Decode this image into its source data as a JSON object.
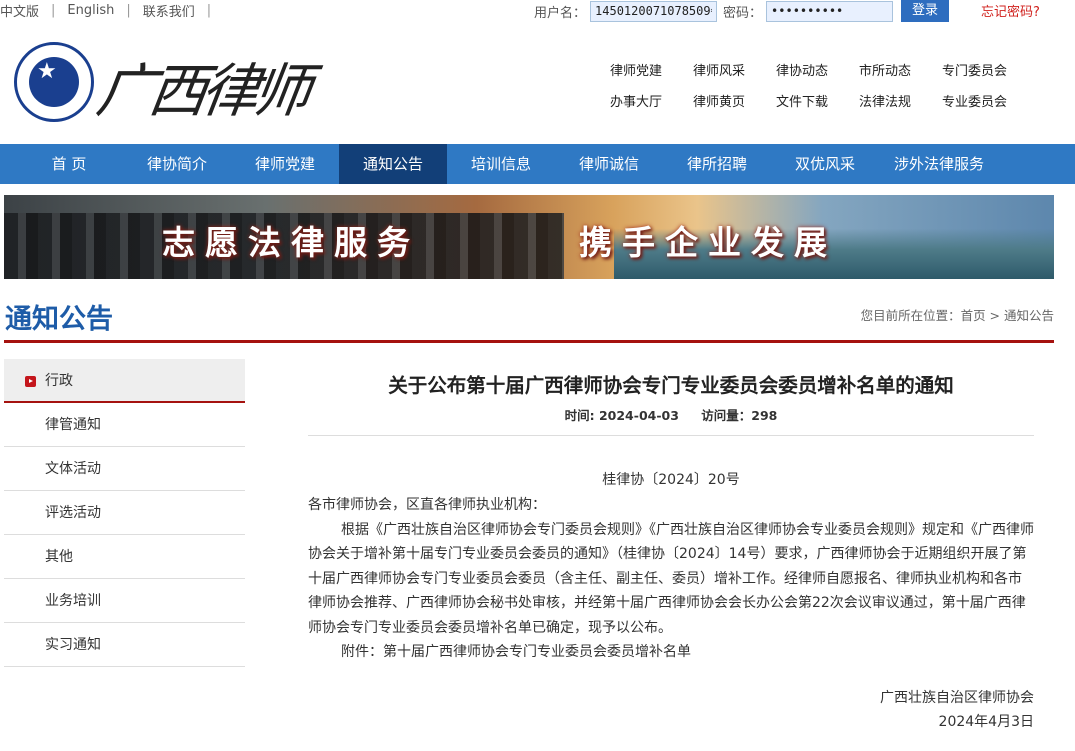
{
  "topbar": {
    "lang_cn": "中文版",
    "lang_en": "English",
    "contact": "联系我们",
    "username_label": "用户名：",
    "username_value": "1450120071078509€",
    "password_label": "密码：",
    "password_value": "••••••••••",
    "login_label": "登录",
    "forgot_label": "忘记密码?"
  },
  "header": {
    "logo_text": "广西律师",
    "quick_links": [
      "律师党建",
      "律师风采",
      "律协动态",
      "市所动态",
      "专门委员会",
      "办事大厅",
      "律师黄页",
      "文件下载",
      "法律法规",
      "专业委员会"
    ]
  },
  "nav": {
    "items": [
      "首 页",
      "律协简介",
      "律师党建",
      "通知公告",
      "培训信息",
      "律师诚信",
      "律所招聘",
      "双优风采",
      "涉外法律服务"
    ],
    "active": "通知公告"
  },
  "banner": {
    "slogan_left": "志愿法律服务",
    "slogan_right": "携手企业发展"
  },
  "section": {
    "title": "通知公告",
    "breadcrumb": "您目前所在位置：首页 > 通知公告"
  },
  "sidebar": {
    "items": [
      "行政",
      "律管通知",
      "文体活动",
      "评选活动",
      "其他",
      "业务培训",
      "实习通知"
    ]
  },
  "article": {
    "title": "关于公布第十届广西律师协会专门专业委员会委员增补名单的通知",
    "date": "时间: 2024-04-03",
    "views": "访问量：298",
    "doc_no": "桂律协〔2024〕20号",
    "salutation": "各市律师协会，区直各律师执业机构：",
    "body": "根据《广西壮族自治区律师协会专门委员会规则》《广西壮族自治区律师协会专业委员会规则》规定和《广西律师协会关于增补第十届专门专业委员会委员的通知》（桂律协〔2024〕14号）要求，广西律师协会于近期组织开展了第十届广西律师协会专门专业委员会委员（含主任、副主任、委员）增补工作。经律师自愿报名、律师执业机构和各市律师协会推荐、广西律师协会秘书处审核，并经第十届广西律师协会会长办公会第22次会议审议通过，第十届广西律师协会专门专业委员会委员增补名单已确定，现予以公布。",
    "attachment": "附件：第十届广西律师协会专门专业委员会委员增补名单",
    "sign_org": "广西壮族自治区律师协会",
    "sign_date": "2024年4月3日"
  }
}
